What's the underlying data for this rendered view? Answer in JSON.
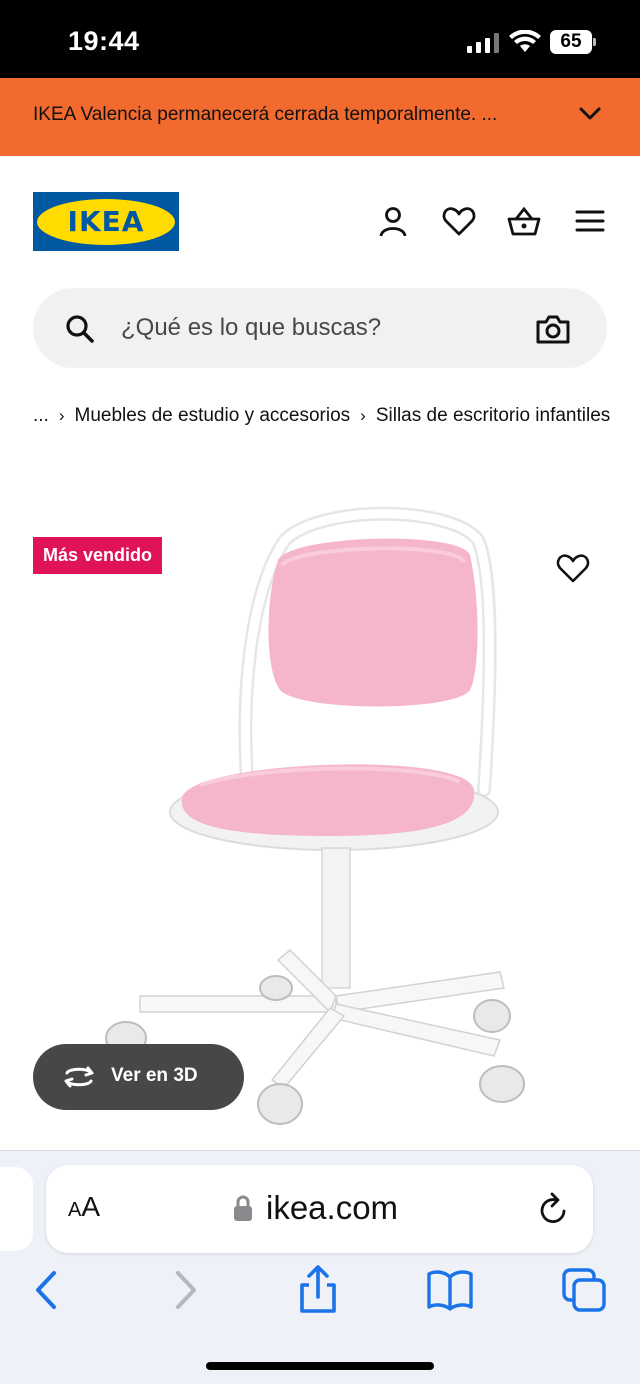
{
  "status_bar": {
    "time": "19:44",
    "battery": "65"
  },
  "banner": {
    "text": "IKEA Valencia permanecerá cerrada temporalmente. ..."
  },
  "header": {
    "logo_text": "IKEA",
    "icons": [
      "user-icon",
      "heart-icon",
      "basket-icon",
      "menu-icon"
    ]
  },
  "search": {
    "placeholder": "¿Qué es lo que buscas?"
  },
  "breadcrumb": {
    "ellipsis": "...",
    "items": [
      "Muebles de estudio y accesorios",
      "Sillas de escritorio infantiles"
    ]
  },
  "product": {
    "badge": "Más vendido",
    "view_3d": "Ver en 3D",
    "colors": {
      "seat": "#f5b6cc",
      "frame": "#ffffff",
      "badge": "#e0135a"
    }
  },
  "browser": {
    "aa_small": "A",
    "aa_large": "A",
    "url": "ikea.com"
  },
  "colors": {
    "banner": "#f26a2e",
    "ikea_blue": "#0058a3",
    "ikea_yellow": "#ffdb00",
    "safari_blue": "#1a73e8"
  }
}
